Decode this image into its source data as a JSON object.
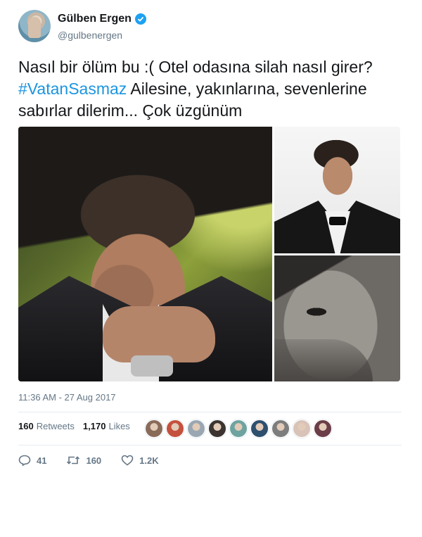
{
  "user": {
    "display_name": "Gülben Ergen",
    "handle": "@gulbenergen",
    "verified_icon": "verified-badge-icon"
  },
  "tweet": {
    "text_before": "Nasıl bir ölüm bu :( Otel odasına silah nasıl girer? ",
    "hashtag": "#VatanSasmaz",
    "text_after": " Ailesine, yakınlarına, sevenlerine sabırlar dilerim... Çok üzgünüm",
    "timestamp": "11:36 AM - 27 Aug 2017"
  },
  "stats": {
    "retweets_count": "160",
    "retweets_label": "Retweets",
    "likes_count": "1,170",
    "likes_label": "Likes"
  },
  "likers": [
    "#8a6b5a",
    "#c4513e",
    "#9aa7b2",
    "#3b3430",
    "#6fa3a0",
    "#2f4f6e",
    "#7d7d7d",
    "#d9c3b8",
    "#6b3d48"
  ],
  "actions": {
    "reply_count": "41",
    "retweet_count": "160",
    "like_count": "1.2K"
  },
  "colors": {
    "accent": "#1da1f2",
    "hashtag": "#1b95e0",
    "muted": "#657786"
  }
}
